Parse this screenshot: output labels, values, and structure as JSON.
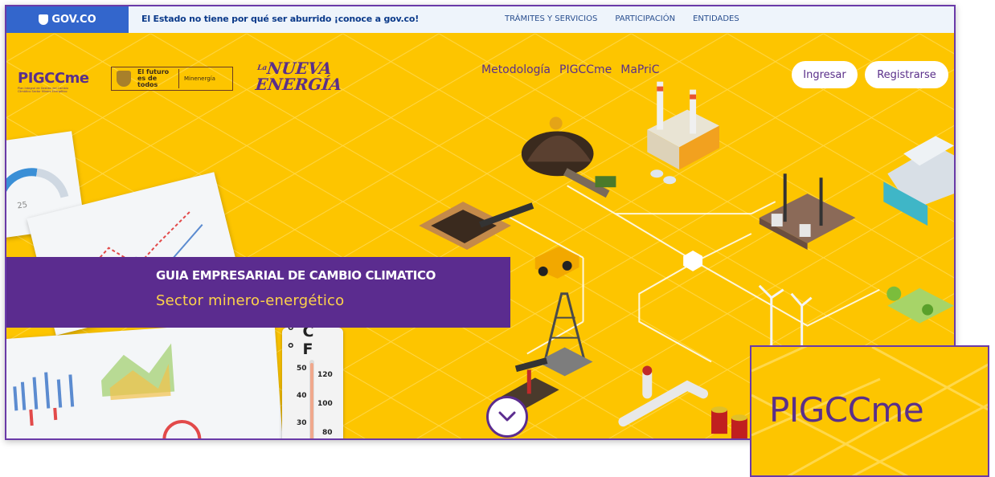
{
  "govbar": {
    "logo_text": "GOV.CO",
    "tagline": "El Estado no tiene por qué ser aburrido ¡conoce a gov.co!",
    "nav": [
      "TRÁMITES Y SERVICIOS",
      "PARTICIPACIÓN",
      "ENTIDADES"
    ]
  },
  "header": {
    "logo_pigcc": "PIGCCme",
    "logo_pigcc_sub": "Plan Integral de Gestión del Cambio Climático Sector Minero Energético",
    "gov_logo_futuro": "El futuro es de todos",
    "gov_logo_min": "Minenergía",
    "nueva_pre": "La",
    "nueva_main": "NUEVA",
    "nueva_sub": "ENERGÍA",
    "nav": [
      "Metodología",
      "PIGCCme",
      "MaPriC"
    ],
    "login_label": "Ingresar",
    "register_label": "Registrarse"
  },
  "banner": {
    "title": "GUIA EMPRESARIAL DE CAMBIO CLIMATICO",
    "subtitle": "Sector minero-energético"
  },
  "thermometer": {
    "units": "°C °F",
    "c_labels": [
      "50",
      "40",
      "30"
    ],
    "f_labels": [
      "120",
      "100",
      "80"
    ]
  },
  "papers": {
    "gauge_value": "25"
  },
  "inset": {
    "zoom_text": "PIGCCme"
  },
  "colors": {
    "brand_yellow": "#fdc500",
    "brand_purple": "#5b2c8f",
    "gov_blue": "#3366cc"
  }
}
